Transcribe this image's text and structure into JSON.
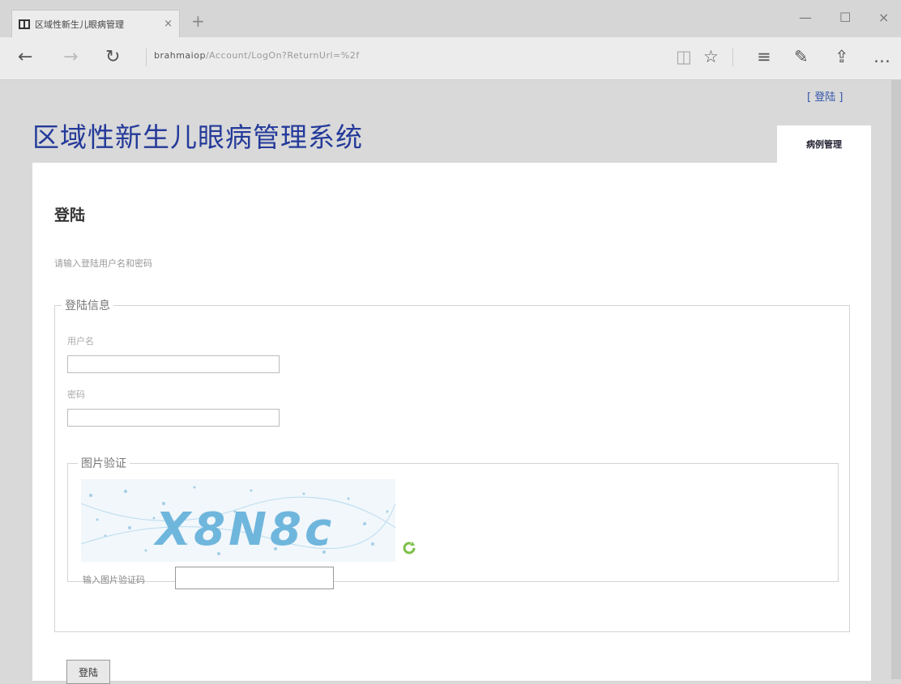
{
  "browser": {
    "tab_title": "区域性新生儿眼病管理",
    "tab_close": "×",
    "new_tab": "+",
    "url_host": "brahmaiop",
    "url_path": "/Account/LogOn?ReturnUrl=%2f",
    "window": {
      "minimize": "—",
      "maximize": "☐",
      "close": "×"
    },
    "nav": {
      "back": "←",
      "forward": "→",
      "refresh": "↻"
    },
    "tools": {
      "reading_view": "◫",
      "favorite": "☆",
      "hub": "≡",
      "web_note": "✎",
      "share": "⇪",
      "more": "…"
    }
  },
  "header": {
    "login_link": "[ 登陆 ]",
    "site_title": "区域性新生儿眼病管理系统",
    "menu_tab": "病例管理"
  },
  "main": {
    "heading": "登陆",
    "hint": "请输入登陆用户名和密码",
    "form": {
      "legend": "登陆信息",
      "username_label": "用户名",
      "username_value": "",
      "password_label": "密码",
      "password_value": "",
      "captcha": {
        "legend": "图片验证",
        "image_text": "X8N8c",
        "input_label": "输入图片验证码",
        "input_value": ""
      },
      "submit_label": "登陆"
    }
  },
  "colors": {
    "title": "#243a9a",
    "captcha_text": "#6fb6dd",
    "refresh_icon": "#7cc04a"
  }
}
